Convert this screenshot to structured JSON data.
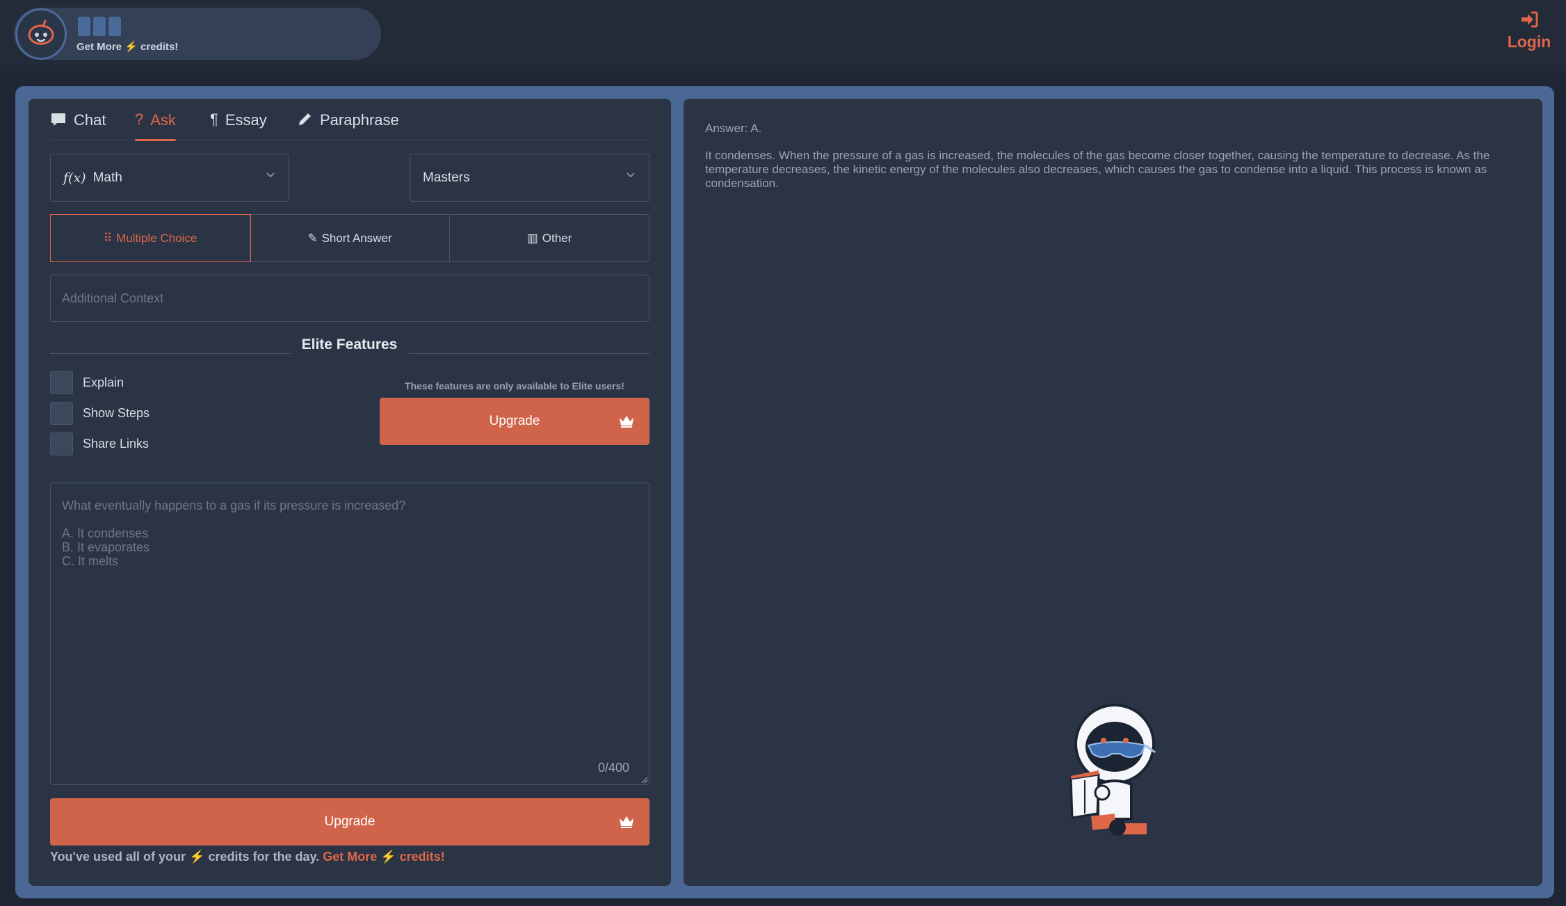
{
  "header": {
    "get_more_prefix": "Get More",
    "get_more_suffix": "credits!",
    "login_label": "Login"
  },
  "tabs": [
    {
      "label": "Chat",
      "icon": "chat-bubble-icon",
      "active": false
    },
    {
      "label": "Ask",
      "icon": "question-icon",
      "active": true
    },
    {
      "label": "Essay",
      "icon": "paragraph-icon",
      "active": false
    },
    {
      "label": "Paraphrase",
      "icon": "pencil-icon",
      "active": false
    }
  ],
  "subject_select": {
    "value": "Math",
    "icon": "function-icon"
  },
  "level_select": {
    "value": "Masters"
  },
  "question_types": [
    {
      "label": "Multiple Choice",
      "icon": "grid-dots-icon",
      "active": true
    },
    {
      "label": "Short Answer",
      "icon": "pen-scribble-icon",
      "active": false
    },
    {
      "label": "Other",
      "icon": "books-icon",
      "active": false
    }
  ],
  "context": {
    "placeholder": "Additional Context"
  },
  "elite": {
    "title": "Elite Features",
    "options": [
      "Explain",
      "Show Steps",
      "Share Links"
    ],
    "note": "These features are only available to Elite users!",
    "upgrade_label": "Upgrade"
  },
  "question": {
    "placeholder": "What eventually happens to a gas if its pressure is increased?\n\nA. It condenses\nB. It evaporates\nC. It melts",
    "counter": "0/400"
  },
  "submit": {
    "label": "Upgrade"
  },
  "footer": {
    "prefix": "You've used all of your",
    "middle": "credits for the day.",
    "link_prefix": "Get More",
    "link_suffix": "credits!"
  },
  "answer": {
    "head": "Answer: A.",
    "body": "It condenses. When the pressure of a gas is increased, the molecules of the gas become closer together, causing the temperature to decrease. As the temperature decreases, the kinetic energy of the molecules also decreases, which causes the gas to condense into a liquid. This process is known as condensation."
  },
  "colors": {
    "accent": "#e0664a",
    "frame": "#4a6893",
    "panel": "#2a3445",
    "background": "#1f2633"
  }
}
